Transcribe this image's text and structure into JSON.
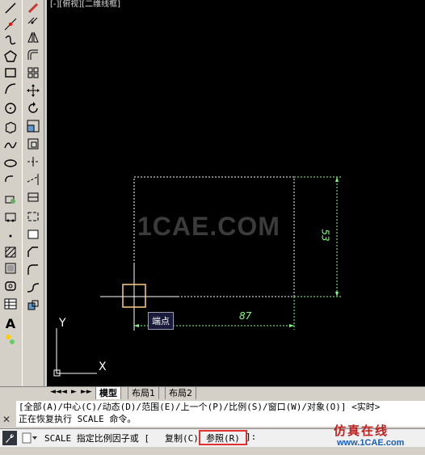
{
  "toolbar_left": {
    "icons": [
      "line-icon",
      "construction-line-icon",
      "polyline-icon",
      "polygon-icon",
      "rectangle-icon",
      "arc-icon",
      "circle-icon",
      "revision-cloud-icon",
      "spline-icon",
      "ellipse-icon",
      "ellipse-arc-icon",
      "insert-block-icon",
      "make-block-icon",
      "point-icon",
      "hatch-icon",
      "gradient-icon",
      "region-icon",
      "table-icon",
      "multiline-text-icon",
      "add-selected-icon"
    ],
    "text_icon_label": "A"
  },
  "toolbar_right": {
    "icons": [
      "erase-icon",
      "copy-icon",
      "mirror-icon",
      "offset-icon",
      "array-icon",
      "move-icon",
      "rotate-icon",
      "scale-icon",
      "stretch-icon",
      "trim-icon",
      "extend-icon",
      "break-at-point-icon",
      "break-icon",
      "join-icon",
      "chamfer-icon",
      "fillet-icon",
      "blend-curves-icon",
      "explode-icon"
    ]
  },
  "viewport": {
    "label": "[-][俯视][二维线框]",
    "watermark": "1CAE.COM",
    "tooltip": "端点",
    "dim_horizontal": "87",
    "dim_vertical": "53",
    "ucs_y": "Y",
    "ucs_x": "X"
  },
  "layout_tabs": {
    "nav": [
      "◄◄",
      "◄",
      "►",
      "►►"
    ],
    "tabs": [
      "模型",
      "布局1",
      "布局2"
    ]
  },
  "command": {
    "history": [
      "[全部(A)/中心(C)/动态(D)/范围(E)/上一个(P)/比例(S)/窗口(W)/对象(O)] <实时>",
      "正在恢复执行 SCALE 命令。"
    ],
    "prompt": "SCALE 指定比例因子或 [",
    "option_copy": "复制(C)",
    "option_reference": "参照(R)",
    "prompt_end": "]:",
    "close_label": "✕"
  },
  "watermarks": {
    "brand_cn": "仿真在线",
    "brand_url": "www.1CAE.com"
  },
  "colors": {
    "canvas": "#000000",
    "dashed_preview": "#ffffff",
    "dimension": "#7fff7f",
    "cursor_box": "#ffcc88",
    "highlight_box": "#e03030"
  }
}
